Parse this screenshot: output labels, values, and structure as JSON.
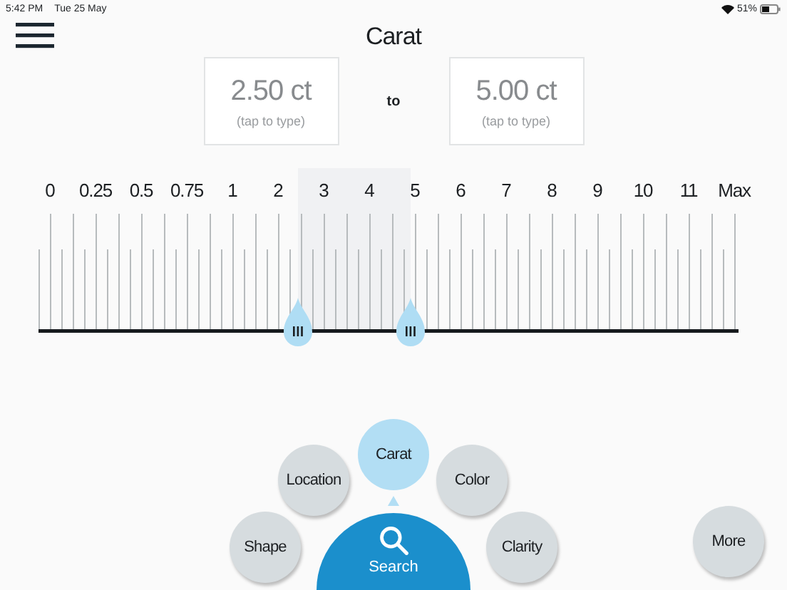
{
  "status_bar": {
    "time": "5:42 PM",
    "date": "Tue 25 May",
    "battery": "51%"
  },
  "title": "Carat",
  "range": {
    "min": {
      "value": "2.50 ct",
      "hint": "(tap to type)"
    },
    "separator": "to",
    "max": {
      "value": "5.00 ct",
      "hint": "(tap to type)"
    }
  },
  "scale": {
    "labels": [
      "0",
      "0.25",
      "0.5",
      "0.75",
      "1",
      "2",
      "3",
      "4",
      "5",
      "6",
      "7",
      "8",
      "9",
      "10",
      "11",
      "Max"
    ],
    "low": {
      "level": 0.371
    },
    "high": {
      "level": 0.533
    }
  },
  "filters": [
    {
      "label": "Shape",
      "selected": false
    },
    {
      "label": "Location",
      "selected": false
    },
    {
      "label": "Carat",
      "selected": true
    },
    {
      "label": "Color",
      "selected": false
    },
    {
      "label": "Clarity",
      "selected": false
    }
  ],
  "search_button": "Search",
  "more_button": "More"
}
